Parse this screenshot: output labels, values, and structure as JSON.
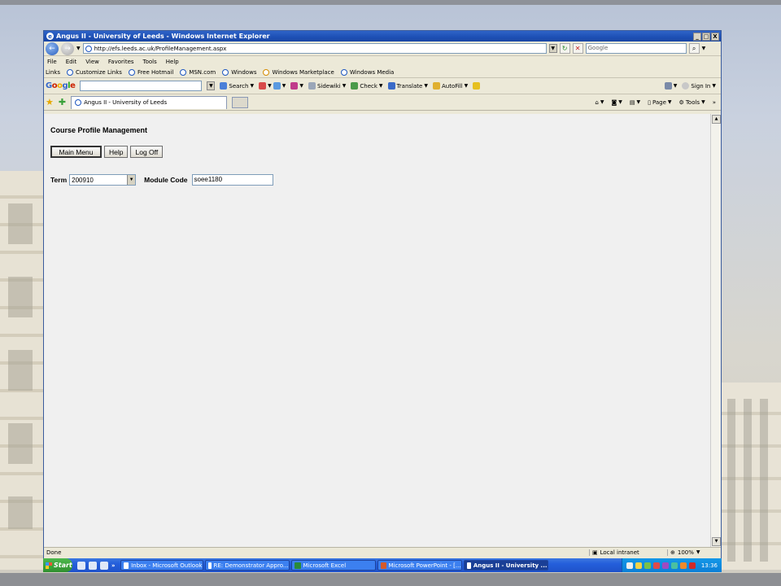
{
  "window": {
    "title": "Angus II - University of Leeds - Windows Internet Explorer",
    "controls": [
      "_",
      "□",
      "X"
    ]
  },
  "address": {
    "url": "http://efs.leeds.ac.uk/ProfileManagement.aspx",
    "search_placeholder": "Google"
  },
  "menu": [
    "File",
    "Edit",
    "View",
    "Favorites",
    "Tools",
    "Help"
  ],
  "links": {
    "label": "Links",
    "items": [
      "Customize Links",
      "Free Hotmail",
      "MSN.com",
      "Windows",
      "Windows Marketplace",
      "Windows Media"
    ]
  },
  "google_toolbar": {
    "logo": [
      "G",
      "o",
      "o",
      "g",
      "l",
      "e"
    ],
    "search_label": "Search",
    "sidewiki_label": "Sidewiki",
    "check_label": "Check",
    "translate_label": "Translate",
    "autofill_label": "AutoFill",
    "signin_label": "Sign In"
  },
  "tabs": {
    "active_title": "Angus II - University of Leeds",
    "page_label": "Page",
    "tools_label": "Tools"
  },
  "page": {
    "title": "Course Profile Management",
    "buttons": {
      "main_menu": "Main Menu",
      "help": "Help",
      "log_off": "Log Off"
    },
    "term_label": "Term",
    "term_value": "200910",
    "module_code_label": "Module Code",
    "module_code_value": "soee1180"
  },
  "status": {
    "text": "Done",
    "zone": "Local intranet",
    "zoom": "100%"
  },
  "taskbar": {
    "start_label": "Start",
    "tasks": [
      "Inbox - Microsoft Outlook",
      "RE: Demonstrator Appro...",
      "Microsoft Excel",
      "Microsoft PowerPoint - [...",
      "Angus II - University ..."
    ],
    "clock": "13:36"
  },
  "colors": {
    "titlebar": "#1d4fb4",
    "page_bg": "#f0f0f0",
    "taskbar": "#245edb",
    "start": "#2f8f2f"
  }
}
